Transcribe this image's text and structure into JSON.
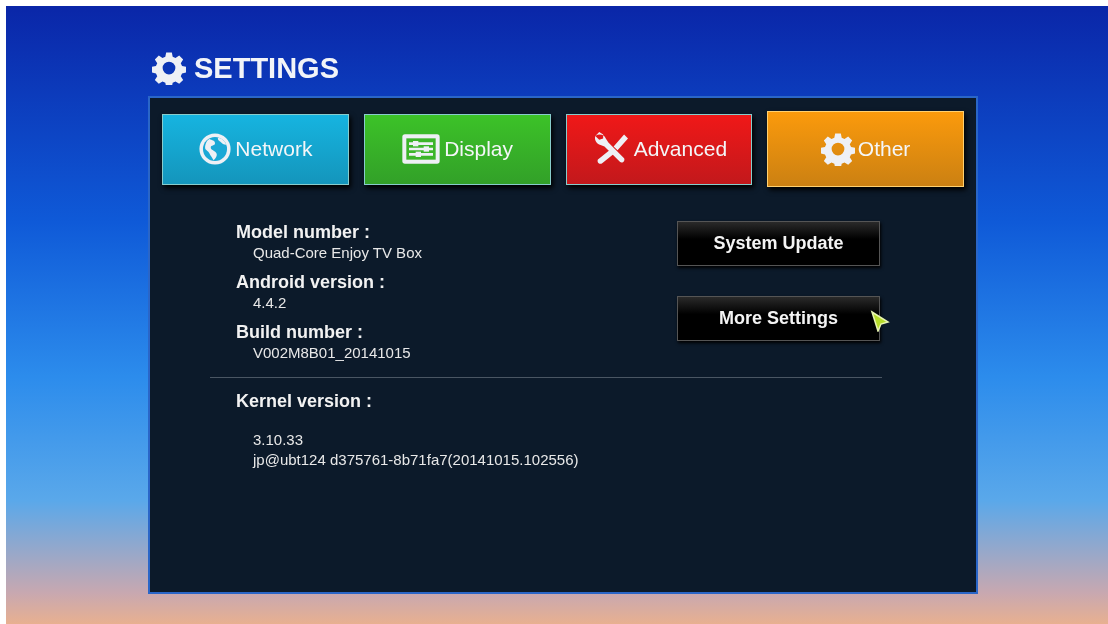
{
  "header": {
    "title": "SETTINGS"
  },
  "tabs": [
    {
      "label": "Network",
      "color": "#16b4e0",
      "selected": false
    },
    {
      "label": "Display",
      "color": "#3cc228",
      "selected": false
    },
    {
      "label": "Advanced",
      "color": "#f01818",
      "selected": false
    },
    {
      "label": "Other",
      "color": "#fb9a0c",
      "selected": true
    }
  ],
  "info": [
    {
      "label": "Model number :",
      "value": [
        "Quad-Core Enjoy TV Box"
      ]
    },
    {
      "label": "Android version :",
      "value": [
        "4.4.2"
      ]
    },
    {
      "label": "Build number :",
      "value": [
        "V002M8B01_20141015"
      ]
    }
  ],
  "kernel": {
    "label": "Kernel version :",
    "value": [
      "3.10.33",
      "jp@ubt124 d375761-8b71fa7(20141015.102556)"
    ]
  },
  "buttons": [
    {
      "label": "System Update",
      "hovered": false
    },
    {
      "label": "More Settings",
      "hovered": true
    }
  ]
}
